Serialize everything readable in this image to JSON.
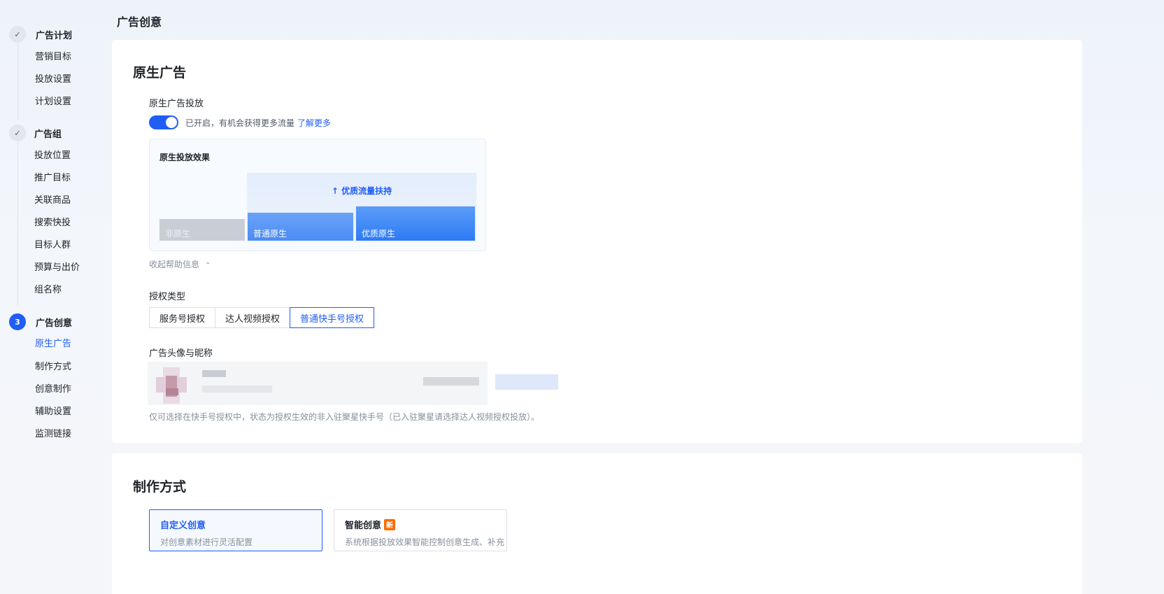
{
  "page": {
    "title": "广告创意"
  },
  "steps": [
    {
      "index": "✓",
      "title": "广告计划",
      "items": [
        "营销目标",
        "投放设置",
        "计划设置"
      ]
    },
    {
      "index": "✓",
      "title": "广告组",
      "items": [
        "投放位置",
        "推广目标",
        "关联商品",
        "搜索快投",
        "目标人群",
        "预算与出价",
        "组名称"
      ]
    },
    {
      "index": "3",
      "title": "广告创意",
      "items": [
        "原生广告",
        "制作方式",
        "创意制作",
        "辅助设置",
        "监测链接"
      ],
      "active_item": "原生广告"
    }
  ],
  "native_ad": {
    "section_title": "原生广告",
    "field_label": "原生广告投放",
    "toggle_on": true,
    "toggle_text": "已开启，有机会获得更多流量",
    "learn_more": "了解更多",
    "effect": {
      "title": "原生投放效果",
      "boost_label": "优质流量扶持",
      "bars": [
        {
          "label": "非原生",
          "level": 1
        },
        {
          "label": "普通原生",
          "level": 2
        },
        {
          "label": "优质原生",
          "level": 3
        }
      ]
    },
    "collapse_help": "收起帮助信息",
    "auth_type_label": "授权类型",
    "auth_tabs": [
      "服务号授权",
      "达人视频授权",
      "普通快手号授权"
    ],
    "auth_selected": "普通快手号授权",
    "avatar_label": "广告头像与昵称",
    "hint": "仅可选择在快手号授权中，状态为授权生效的非入驻聚星快手号（已入驻聚星请选择达人视频授权投放）。"
  },
  "production": {
    "section_title": "制作方式",
    "options": [
      {
        "title": "自定义创意",
        "desc": "对创意素材进行灵活配置",
        "selected": true,
        "badge": ""
      },
      {
        "title": "智能创意",
        "desc": "系统根据投放效果智能控制创意生成、补充",
        "selected": false,
        "badge": "新"
      }
    ]
  },
  "colors": {
    "primary": "#1f5df5",
    "badge": "#ff6a00"
  }
}
